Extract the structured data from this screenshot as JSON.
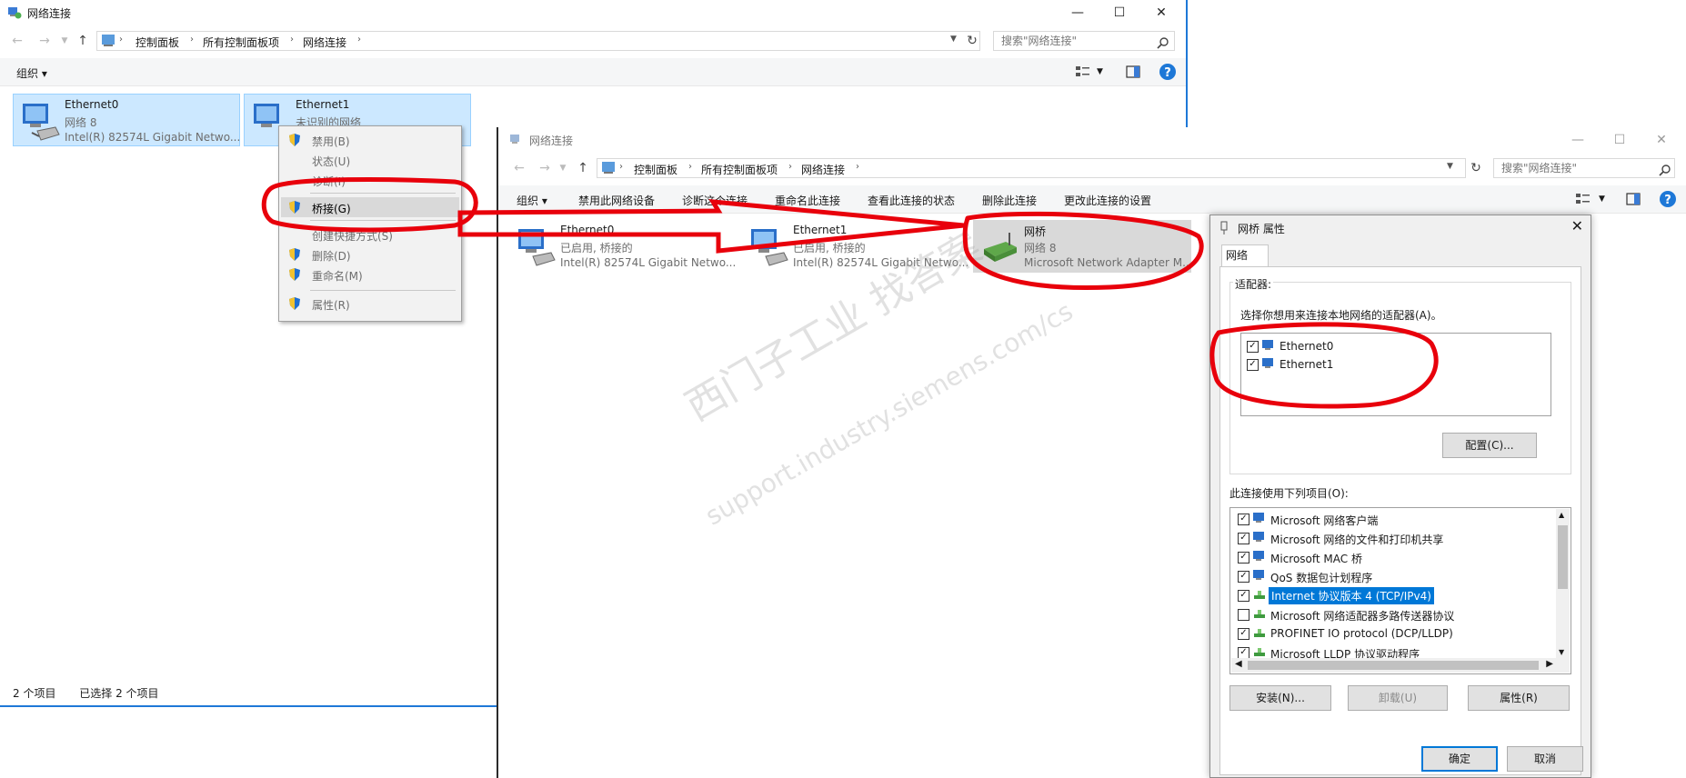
{
  "window_back": {
    "title": "网络连接",
    "breadcrumb": [
      "控制面板",
      "所有控制面板项",
      "网络连接"
    ],
    "search_placeholder": "搜索\"网络连接\"",
    "cmd_organize": "组织 ▾",
    "connections": [
      {
        "name": "Ethernet0",
        "line2": "网络  8",
        "line3": "Intel(R) 82574L Gigabit Netwo..."
      },
      {
        "name": "Ethernet1",
        "line2": "未识别的网络",
        "line3": ""
      }
    ],
    "status_count": "2 个项目",
    "status_selected": "已选择 2 个项目"
  },
  "context_menu": {
    "items": [
      {
        "label": "禁用(B)",
        "shield": true
      },
      {
        "label": "状态(U)",
        "shield": false
      },
      {
        "label": "诊断(I)",
        "shield": false
      },
      {
        "label": "桥接(G)",
        "shield": true
      },
      {
        "label": "创建快捷方式(S)",
        "shield": false
      },
      {
        "label": "删除(D)",
        "shield": true
      },
      {
        "label": "重命名(M)",
        "shield": true
      },
      {
        "label": "属性(R)",
        "shield": true
      }
    ]
  },
  "window_front": {
    "title": "网络连接",
    "breadcrumb": [
      "控制面板",
      "所有控制面板项",
      "网络连接"
    ],
    "search_placeholder": "搜索\"网络连接\"",
    "commands": [
      "组织 ▾",
      "禁用此网络设备",
      "诊断这个连接",
      "重命名此连接",
      "查看此连接的状态",
      "删除此连接",
      "更改此连接的设置"
    ],
    "connections": [
      {
        "name": "Ethernet0",
        "line2": "已启用, 桥接的",
        "line3": "Intel(R) 82574L Gigabit Netwo..."
      },
      {
        "name": "Ethernet1",
        "line2": "已启用, 桥接的",
        "line3": "Intel(R) 82574L Gigabit Netwo..."
      },
      {
        "name": "网桥",
        "line2": "网络  8",
        "line3": "Microsoft Network Adapter M..."
      }
    ]
  },
  "bridge_dialog": {
    "title": "网桥 属性",
    "tab": "网络",
    "adapters_group": "适配器:",
    "adapters_desc": "选择你想用来连接本地网络的适配器(A)。",
    "adapters": [
      {
        "label": "Ethernet0",
        "checked": true
      },
      {
        "label": "Ethernet1",
        "checked": true
      }
    ],
    "configure_btn": "配置(C)...",
    "items_label": "此连接使用下列项目(O):",
    "items": [
      {
        "label": "Microsoft 网络客户端",
        "checked": true,
        "selected": false
      },
      {
        "label": "Microsoft 网络的文件和打印机共享",
        "checked": true,
        "selected": false
      },
      {
        "label": "Microsoft MAC 桥",
        "checked": true,
        "selected": false
      },
      {
        "label": "QoS 数据包计划程序",
        "checked": true,
        "selected": false
      },
      {
        "label": "Internet 协议版本 4 (TCP/IPv4)",
        "checked": true,
        "selected": true
      },
      {
        "label": "Microsoft 网络适配器多路传送器协议",
        "checked": false,
        "selected": false
      },
      {
        "label": "PROFINET IO protocol (DCP/LLDP)",
        "checked": true,
        "selected": false
      },
      {
        "label": "Microsoft LLDP 协议驱动程序",
        "checked": true,
        "selected": false
      }
    ],
    "install_btn": "安装(N)...",
    "uninstall_btn": "卸载(U)",
    "properties_btn": "属性(R)",
    "ok_btn": "确定",
    "cancel_btn": "取消"
  },
  "watermark": {
    "line1": "西门子工业   找答案",
    "line2": "support.industry.siemens.com/cs"
  },
  "colors": {
    "selection": "#cce8ff",
    "accent": "#0078d7",
    "annotation": "#e8000b"
  }
}
